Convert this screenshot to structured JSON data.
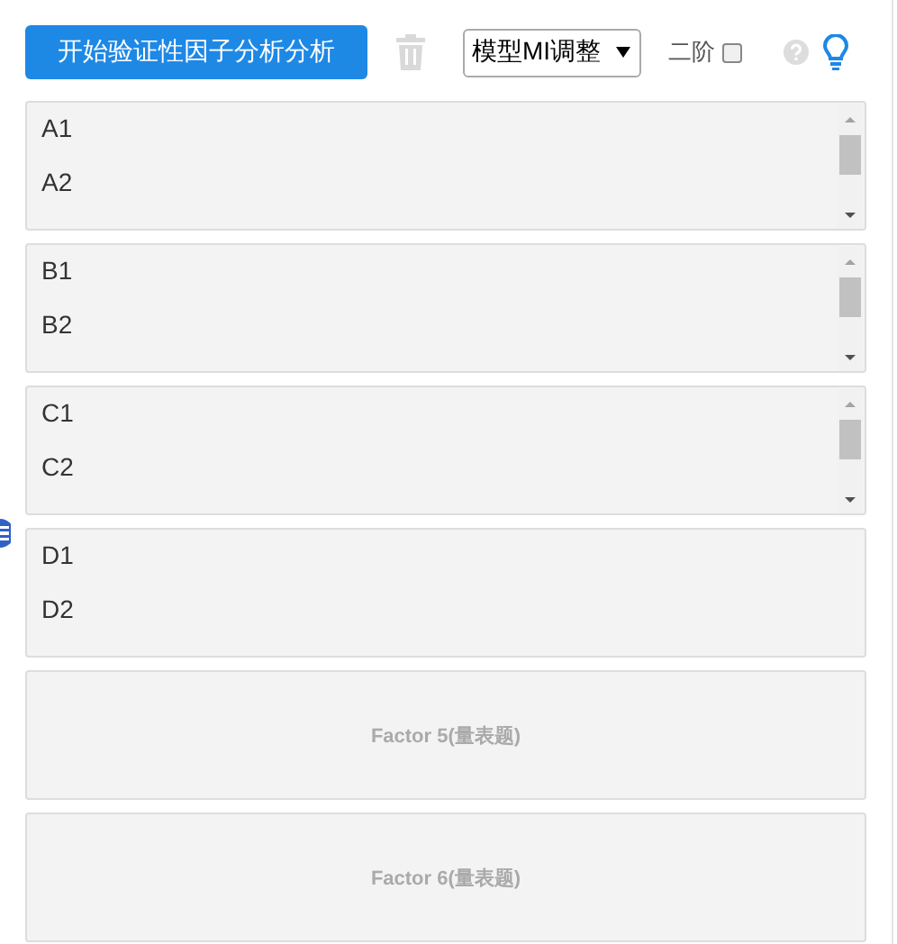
{
  "toolbar": {
    "start_button": "开始验证性因子分析分析",
    "model_select": {
      "value": "模型MI调整"
    },
    "second_order": {
      "label": "二阶",
      "checked": false
    }
  },
  "factors": [
    {
      "kind": "list",
      "scrollbar": true,
      "items": [
        "A1",
        "A2"
      ]
    },
    {
      "kind": "list",
      "scrollbar": true,
      "items": [
        "B1",
        "B2"
      ]
    },
    {
      "kind": "list",
      "scrollbar": true,
      "items": [
        "C1",
        "C2"
      ]
    },
    {
      "kind": "list",
      "scrollbar": false,
      "items": [
        "D1",
        "D2"
      ]
    },
    {
      "kind": "empty",
      "label": "Factor 5(量表题)"
    },
    {
      "kind": "empty",
      "label": "Factor 6(量表题)"
    }
  ]
}
